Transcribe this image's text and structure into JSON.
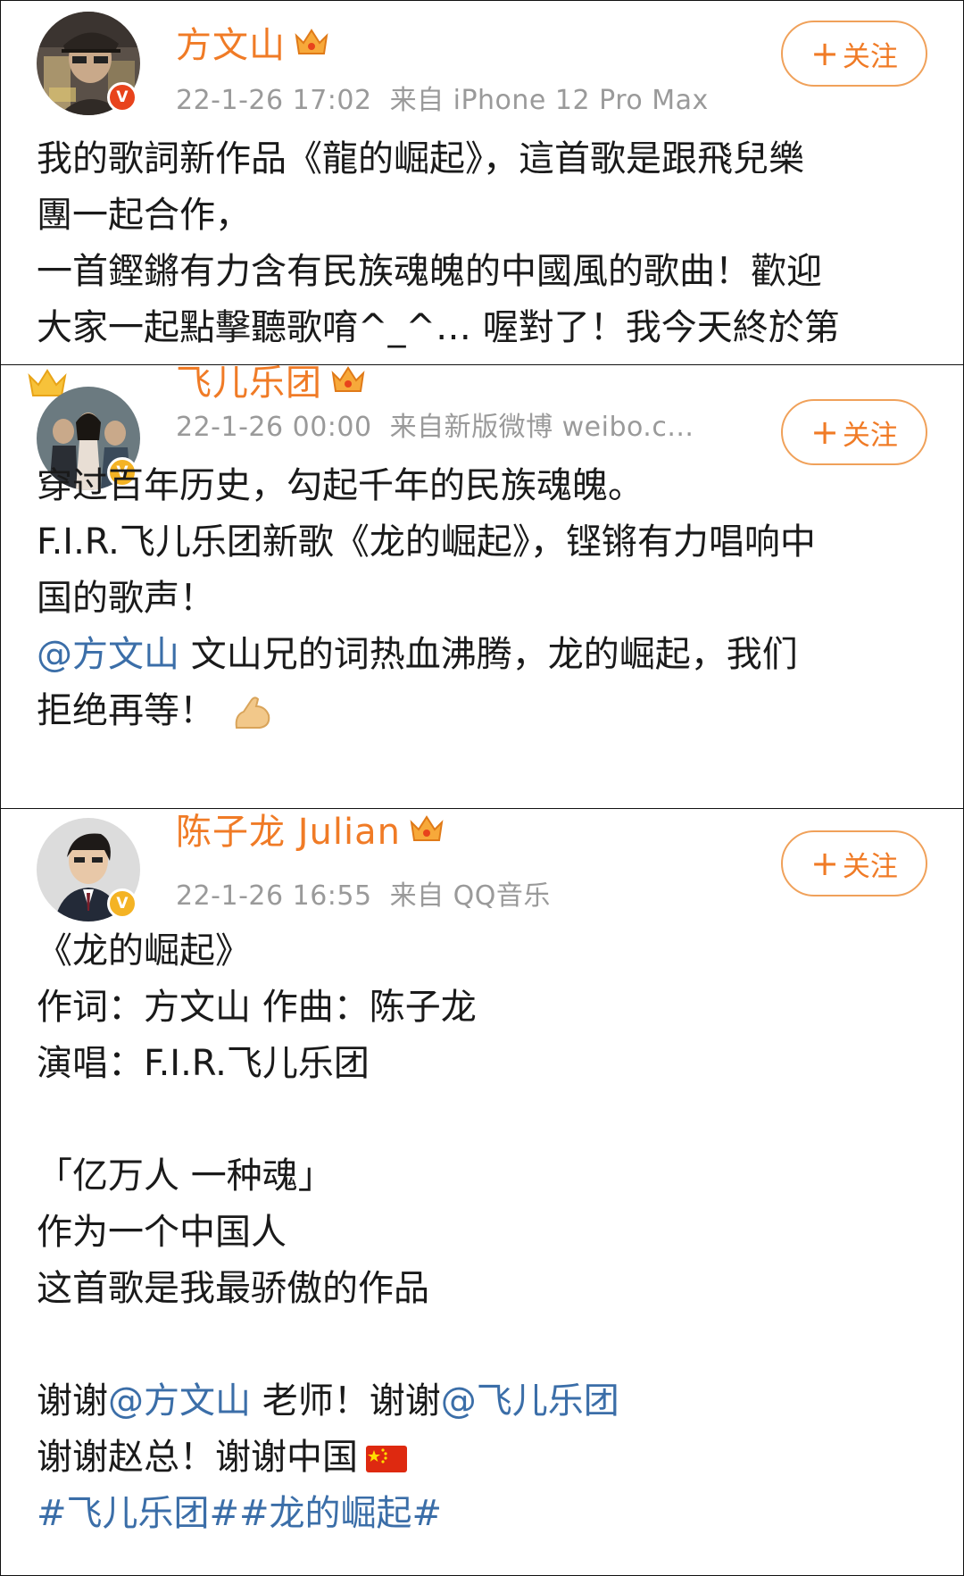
{
  "follow_label": "关注",
  "posts": [
    {
      "author": "方文山",
      "timestamp": "22-1-26 17:02",
      "source": "来自 iPhone 12 Pro Max",
      "badge_color": "#e8431c",
      "lines": [
        "我的歌詞新作品《龍的崛起》，這首歌是跟飛兒樂",
        "團一起合作，",
        "一首鏗鏘有力含有民族魂魄的中國風的歌曲！歡迎",
        "大家一起點擊聽歌唷^_^… 喔對了！我今天終於第"
      ]
    },
    {
      "author": "飞儿乐团",
      "timestamp": "22-1-26 00:00",
      "source": "来自新版微博 weibo.c...",
      "badge_color": "#f4b324",
      "lines": [
        "穿过百年历史，勾起千年的民族魂魄。",
        "F.I.R.飞儿乐团新歌《龙的崛起》，铿锵有力唱响中",
        "国的歌声！"
      ],
      "mention": "@方文山",
      "mention_text": " 文山兄的词热血沸腾，龙的崛起，我们",
      "last_line": "拒绝再等！",
      "emoji": "flexed-biceps-emoji"
    },
    {
      "author": "陈子龙 Julian",
      "timestamp": "22-1-26 16:55",
      "source": "来自 QQ音乐",
      "badge_color": "#f4b324",
      "lines_a": [
        "《龙的崛起》",
        "作词：方文山  作曲：陈子龙",
        "演唱：F.I.R.飞儿乐团"
      ],
      "lines_b": [
        "「亿万人 一种魂」",
        "作为一个中国人",
        "这首歌是我最骄傲的作品"
      ],
      "thanks_1": "谢谢",
      "thanks_mention_1": "@方文山",
      "thanks_mid": " 老师！谢谢",
      "thanks_mention_2": "@飞儿乐团",
      "thanks_line_2": "谢谢赵总！谢谢中国",
      "flag": "china-flag-emoji",
      "hashtags": "#飞儿乐团##龙的崛起#"
    }
  ],
  "colors": {
    "name": "#f07b26",
    "link": "#3b6ea8",
    "meta": "#9a9a9a",
    "follow_border": "#f0a15a"
  }
}
